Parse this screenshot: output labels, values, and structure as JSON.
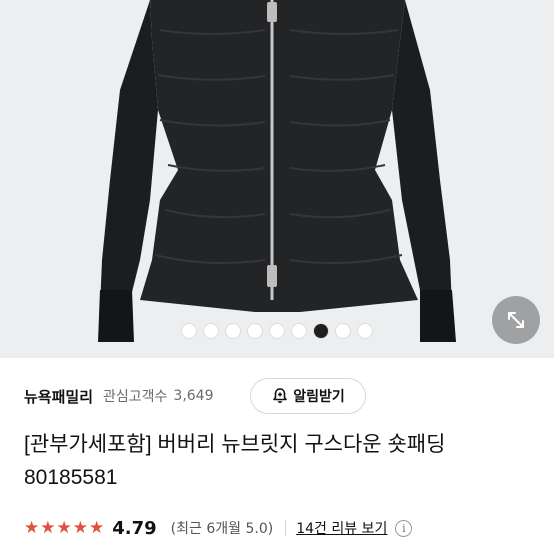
{
  "gallery": {
    "total_images": 9,
    "active_index": 6,
    "expand_icon": "expand-arrows-icon"
  },
  "seller": {
    "name": "뉴욕패밀리",
    "follower_label": "관심고객수",
    "follower_count": "3,649",
    "alarm_button_label": "알림받기",
    "alarm_icon": "bell-plus-icon"
  },
  "product": {
    "title": "[관부가세포함] 버버리 뉴브릿지 구스다운 숏패딩 80185581"
  },
  "rating": {
    "stars_filled": 5,
    "score": "4.79",
    "recent_summary": "(최근 6개월 5.0)",
    "reviews_link": "14건 리뷰 보기",
    "info_icon": "i",
    "star_color": "#e0513e"
  }
}
